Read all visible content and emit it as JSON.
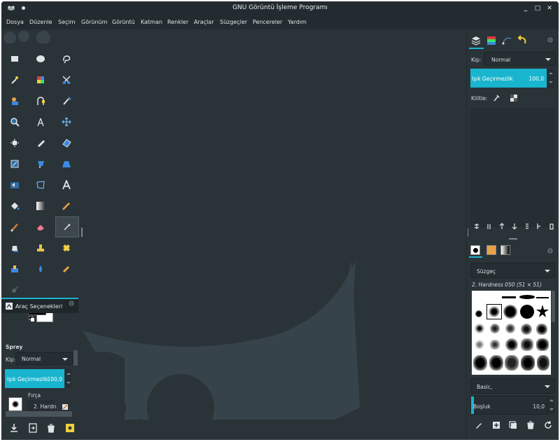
{
  "window": {
    "title": "GNU Görüntü İşleme Programı",
    "minimize": "_",
    "maximize": "□",
    "close": "✕"
  },
  "menubar": {
    "items": [
      "Dosya",
      "Düzenle",
      "Seçim",
      "Görünüm",
      "Görüntü",
      "Katman",
      "Renkler",
      "Araçlar",
      "Süzgeçler",
      "Pencereler",
      "Yardım"
    ]
  },
  "tool_options": {
    "tab_label": "Araç Seçenekleri",
    "tool_name": "Sprey",
    "mode_label": "Kip:",
    "mode_value": "Normal",
    "opacity_label": "Işık Geçirmezlik",
    "opacity_value": "100,0",
    "brush_label": "Fırça",
    "brush_value": "2. Hardn"
  },
  "layers": {
    "mode_label": "Kip:",
    "mode_value": "Normal",
    "opacity_label": "Işık Geçirmezlik",
    "opacity_value": "100,0",
    "lock_label": "Kilitle:"
  },
  "brushes_panel": {
    "filter_value": "Süzgeç",
    "brush_name": "2. Hardness 050 (51 × 51)",
    "preset_value": "Basic,",
    "spacing_label": "Boşluk",
    "spacing_value": "10,0"
  },
  "colors": {
    "accent": "#19b5cf",
    "background": "#2a3338",
    "titlebar": "#232b30",
    "fg_color": "#000000",
    "bg_color": "#ffffff"
  },
  "icons": {
    "tools": [
      "rect-select-icon",
      "ellipse-select-icon",
      "free-select-icon",
      "fuzzy-select-icon",
      "color-select-icon",
      "scissors-select-icon",
      "foreground-select-icon",
      "paths-icon",
      "color-picker-icon",
      "zoom-icon",
      "measure-icon",
      "move-icon",
      "align-icon",
      "crop-icon",
      "unified-transform-icon",
      "rotate-icon",
      "scale-icon",
      "shear-icon",
      "flip-icon",
      "perspective-icon",
      "text-icon",
      "bucket-fill-icon",
      "gradient-icon",
      "pencil-icon",
      "paintbrush-icon",
      "eraser-icon",
      "airbrush-icon",
      "ink-icon",
      "clone-icon",
      "heal-icon",
      "perspective-clone-icon",
      "blur-icon",
      "smudge-icon",
      "dodge-burn-icon"
    ]
  }
}
